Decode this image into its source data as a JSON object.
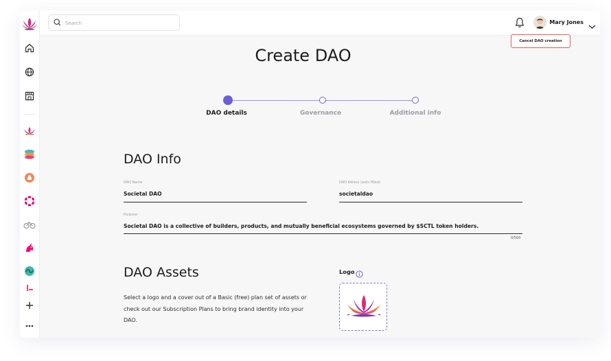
{
  "search": {
    "placeholder": "Search",
    "value": ""
  },
  "user": {
    "name": "Mary Jones"
  },
  "header": {
    "cancel_label": "Cancel DAO creation"
  },
  "page": {
    "title": "Create DAO"
  },
  "stepper": {
    "steps": [
      {
        "label": "DAO details",
        "state": "active"
      },
      {
        "label": "Governance",
        "state": "pending"
      },
      {
        "label": "Additional info",
        "state": "pending"
      }
    ]
  },
  "dao_info": {
    "title": "DAO Info",
    "name_label": "DAO Name",
    "name_value": "Societal DAO",
    "address_label": "DAO Adress (auto filled)",
    "address_value": "societaldao",
    "purpose_label": "Purpose",
    "purpose_value": "Societal DAO is a collective of builders, products, and mutually beneficial ecosystems governed by $SCTL token holders.",
    "purpose_counter": "0/500"
  },
  "dao_assets": {
    "title": "DAO Assets",
    "description": "Select a logo and a cover out of a Basic (free) plan set of assets or check out our Subscription Plans to bring brand identity into your DAO.",
    "logo_label": "Logo"
  },
  "sidebar": {
    "nav": [
      "home-icon",
      "globe-icon",
      "store-icon"
    ],
    "daos": [
      "societal-lotus",
      "layers-dao",
      "orange-dao",
      "polkadot-dao",
      "bikes-dao",
      "unicorn-dao",
      "wave-dao",
      "partial-dao"
    ],
    "actions": [
      "plus-icon",
      "more-icon"
    ]
  },
  "colors": {
    "accent": "#6d5fd8",
    "cancel_border": "#e85a5a",
    "logo_border": "#7a78cf"
  }
}
